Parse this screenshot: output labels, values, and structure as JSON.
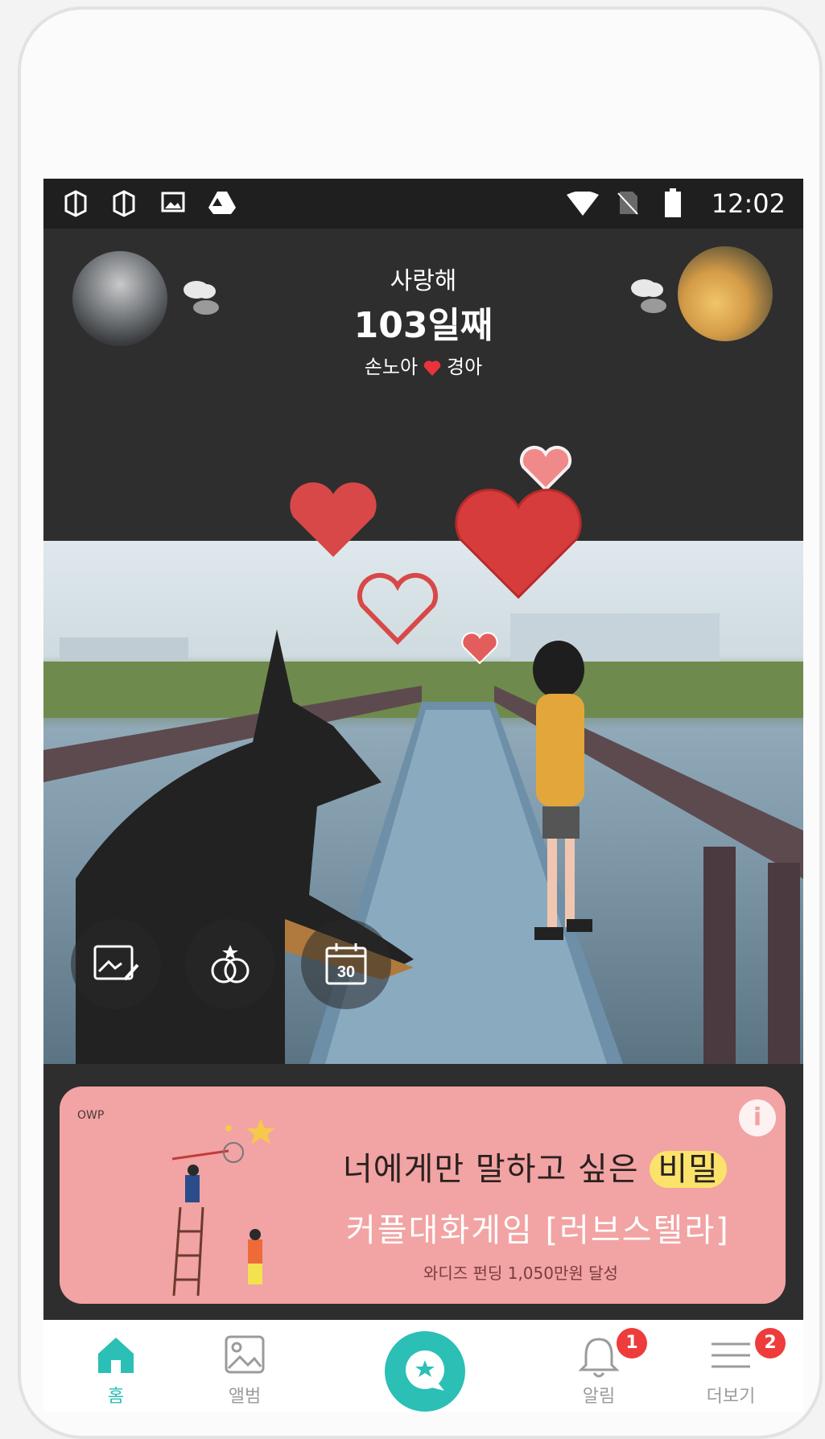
{
  "status_bar": {
    "time": "12:02"
  },
  "header": {
    "subtitle": "사랑해",
    "days": "103일째",
    "name_left": "손노아",
    "name_right": "경아"
  },
  "banner": {
    "logo": "OWP",
    "line1_a": "너에게만 말하고 싶은 ",
    "line1_b": "비밀",
    "line2": "커플대화게임 [러브스텔라]",
    "line3": "와디즈 펀딩 1,050만원 달성",
    "info": "i"
  },
  "actions": {
    "calendar_day": "30"
  },
  "tabs": [
    {
      "label": "홈"
    },
    {
      "label": "앨범"
    },
    {
      "label": ""
    },
    {
      "label": "알림",
      "badge": "1"
    },
    {
      "label": "더보기",
      "badge": "2"
    }
  ],
  "colors": {
    "accent": "#2bbfb6",
    "banner": "#f2a3a3",
    "badge": "#ee3b3b"
  }
}
